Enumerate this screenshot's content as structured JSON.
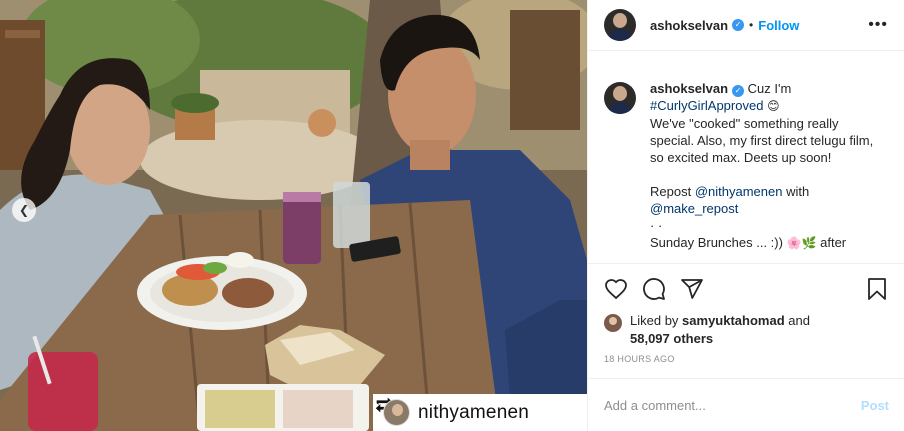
{
  "post": {
    "username": "ashokselvan",
    "follow_label": "Follow",
    "caption": {
      "line1": "Cuz I'm",
      "hashtag": "#CurlyGirlApproved",
      "line2": "We've \"cooked\" something really special. Also, my first direct telugu film, so excited max. Deets up soon!",
      "repost_prefix": "Repost",
      "repost_mention": "@nithyamenen",
      "repost_with": "with",
      "repost_tool": "@make_repost",
      "dots": "· ·",
      "line3": "Sunday Brunches ... :))",
      "line3_after": "after"
    },
    "likes": {
      "prefix": "Liked by",
      "user": "samyuktahomad",
      "and": "and",
      "count": "58,097 others"
    },
    "time": "18 HOURS AGO",
    "comment_placeholder": "Add a comment...",
    "post_label": "Post"
  },
  "photo": {
    "repost_user": "nithyamenen"
  },
  "icons": {
    "more": "more-options-icon",
    "heart": "heart-icon",
    "comment": "comment-icon",
    "share": "share-icon",
    "save": "bookmark-icon",
    "prev": "chevron-left-icon",
    "repost": "repost-icon",
    "verified": "verified-badge-icon"
  },
  "colors": {
    "accent": "#0095f6",
    "link": "#00376b",
    "muted": "#8e8e8e",
    "post_disabled": "#b2dffc"
  }
}
